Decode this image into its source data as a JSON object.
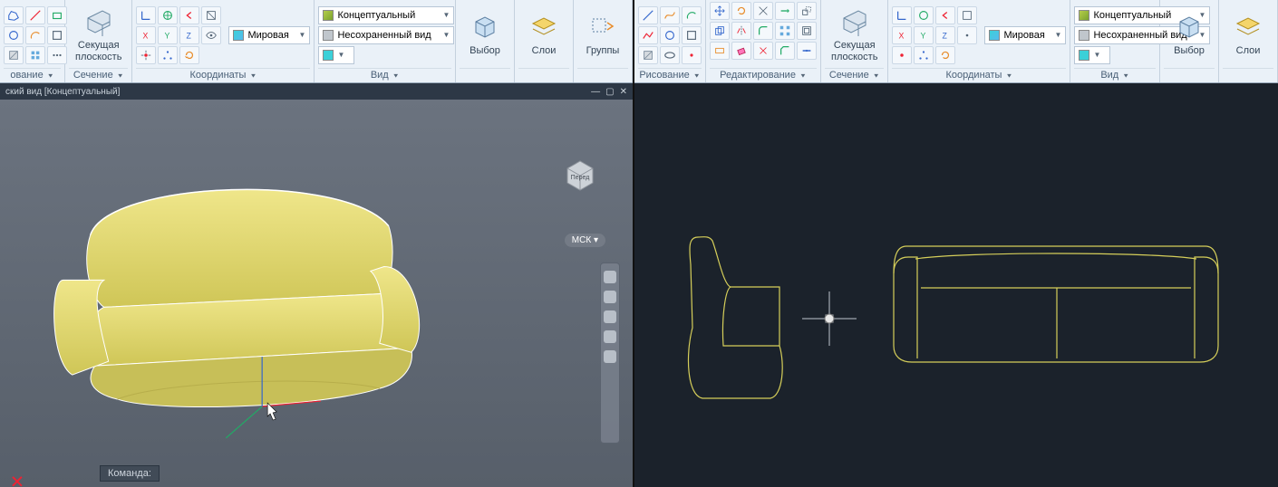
{
  "left": {
    "panels": {
      "draw": "ование",
      "section": "Сечение",
      "coords": "Координаты",
      "view": "Вид"
    },
    "section_btn": "Секущая\nплоскость",
    "combos": {
      "visualstyle": "Концептуальный",
      "view": "Несохраненный вид",
      "ucs": "Мировая"
    },
    "bigbtns": {
      "select": "Выбор",
      "layers": "Слои",
      "groups": "Группы"
    },
    "viewport_title": "ский вид [Концептуальный]",
    "viewcube_face": "Перед",
    "ucs_label": "МСК",
    "cmd_label": "Команда:"
  },
  "right": {
    "panels": {
      "draw": "Рисование",
      "edit": "Редактирование",
      "section": "Сечение",
      "coords": "Координаты",
      "view": "Вид"
    },
    "section_btn": "Секущая\nплоскость",
    "combos": {
      "visualstyle": "Концептуальный",
      "view": "Несохраненный вид",
      "ucs": "Мировая"
    },
    "bigbtns": {
      "select": "Выбор",
      "layers": "Слои"
    }
  }
}
